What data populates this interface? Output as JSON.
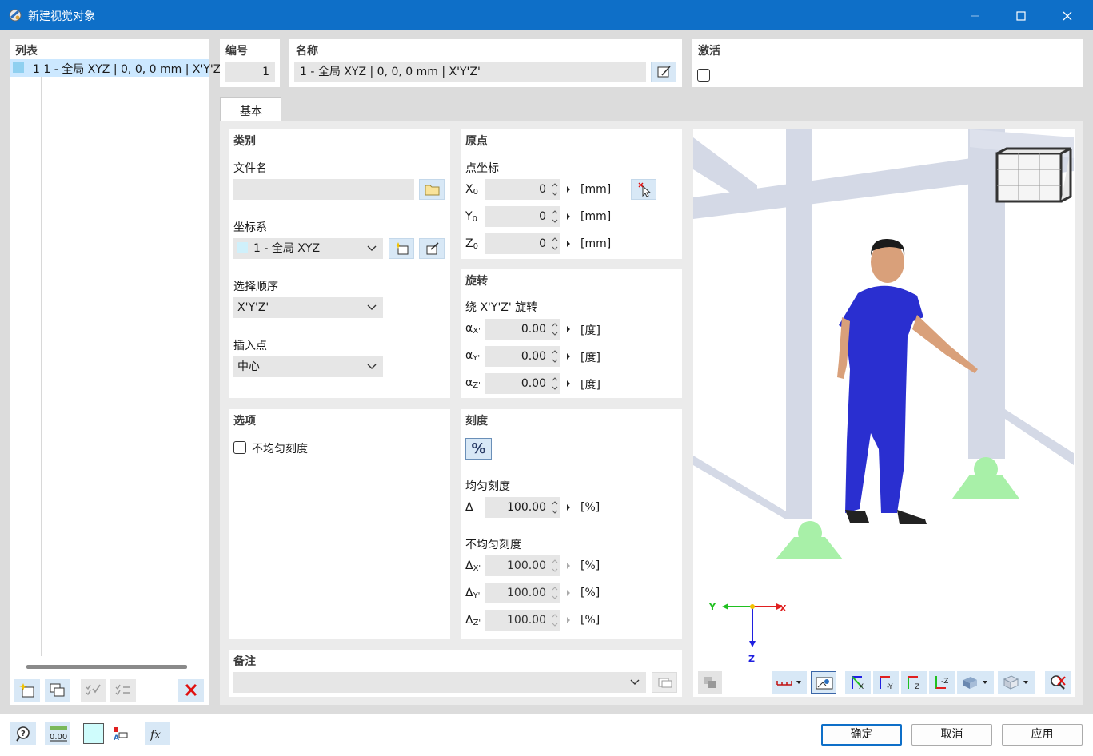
{
  "window": {
    "title": "新建视觉对象",
    "min_icon": "minimize-icon",
    "max_icon": "maximize-icon",
    "close_icon": "close-icon"
  },
  "list": {
    "header": "列表",
    "items": [
      {
        "text": "1  1 - 全局 XYZ | 0, 0, 0 mm | X'Y'Z'"
      }
    ]
  },
  "number": {
    "label": "编号",
    "value": "1"
  },
  "name": {
    "label": "名称",
    "value": "1 - 全局 XYZ | 0, 0, 0 mm | X'Y'Z'"
  },
  "active": {
    "label": "激活",
    "checked": false
  },
  "tabs": [
    {
      "label": "基本"
    }
  ],
  "category": {
    "title": "类别",
    "file_label": "文件名",
    "file_value": "",
    "coord_label": "坐标系",
    "coord_value": "1 - 全局 XYZ",
    "order_label": "选择顺序",
    "order_value": "X'Y'Z'",
    "insert_label": "插入点",
    "insert_value": "中心"
  },
  "origin": {
    "title": "原点",
    "point_label": "点坐标",
    "rows": [
      {
        "axis": "X",
        "sub": "0",
        "value": "0",
        "unit": "[mm]"
      },
      {
        "axis": "Y",
        "sub": "0",
        "value": "0",
        "unit": "[mm]"
      },
      {
        "axis": "Z",
        "sub": "0",
        "value": "0",
        "unit": "[mm]"
      }
    ]
  },
  "rotation": {
    "title": "旋转",
    "about_label": "绕 X'Y'Z' 旋转",
    "rows": [
      {
        "axis": "α",
        "sub": "X'",
        "value": "0.00",
        "unit": "[度]"
      },
      {
        "axis": "α",
        "sub": "Y'",
        "value": "0.00",
        "unit": "[度]"
      },
      {
        "axis": "α",
        "sub": "Z'",
        "value": "0.00",
        "unit": "[度]"
      }
    ]
  },
  "options": {
    "title": "选项",
    "nonuniform_label": "不均匀刻度",
    "nonuniform_checked": false
  },
  "scale": {
    "title": "刻度",
    "percent_btn": "%",
    "uniform_label": "均匀刻度",
    "uniform_row": {
      "axis": "Δ",
      "value": "100.00",
      "unit": "[%]"
    },
    "nonuniform_label": "不均匀刻度",
    "rows": [
      {
        "axis": "Δ",
        "sub": "X'",
        "value": "100.00",
        "unit": "[%]"
      },
      {
        "axis": "Δ",
        "sub": "Y'",
        "value": "100.00",
        "unit": "[%]"
      },
      {
        "axis": "Δ",
        "sub": "Z'",
        "value": "100.00",
        "unit": "[%]"
      }
    ]
  },
  "notes": {
    "title": "备注",
    "value": ""
  },
  "axes": {
    "x": "X",
    "y": "Y",
    "z": "Z"
  },
  "buttons": {
    "ok": "确定",
    "cancel": "取消",
    "apply": "应用"
  },
  "colors": {
    "titlebar": "#0e6fc8",
    "accent": "#0e6fc8",
    "select": "#cce8ff",
    "structure": "#d4d9e6",
    "support": "#a8f0a8",
    "person": "#2a2fd0"
  }
}
